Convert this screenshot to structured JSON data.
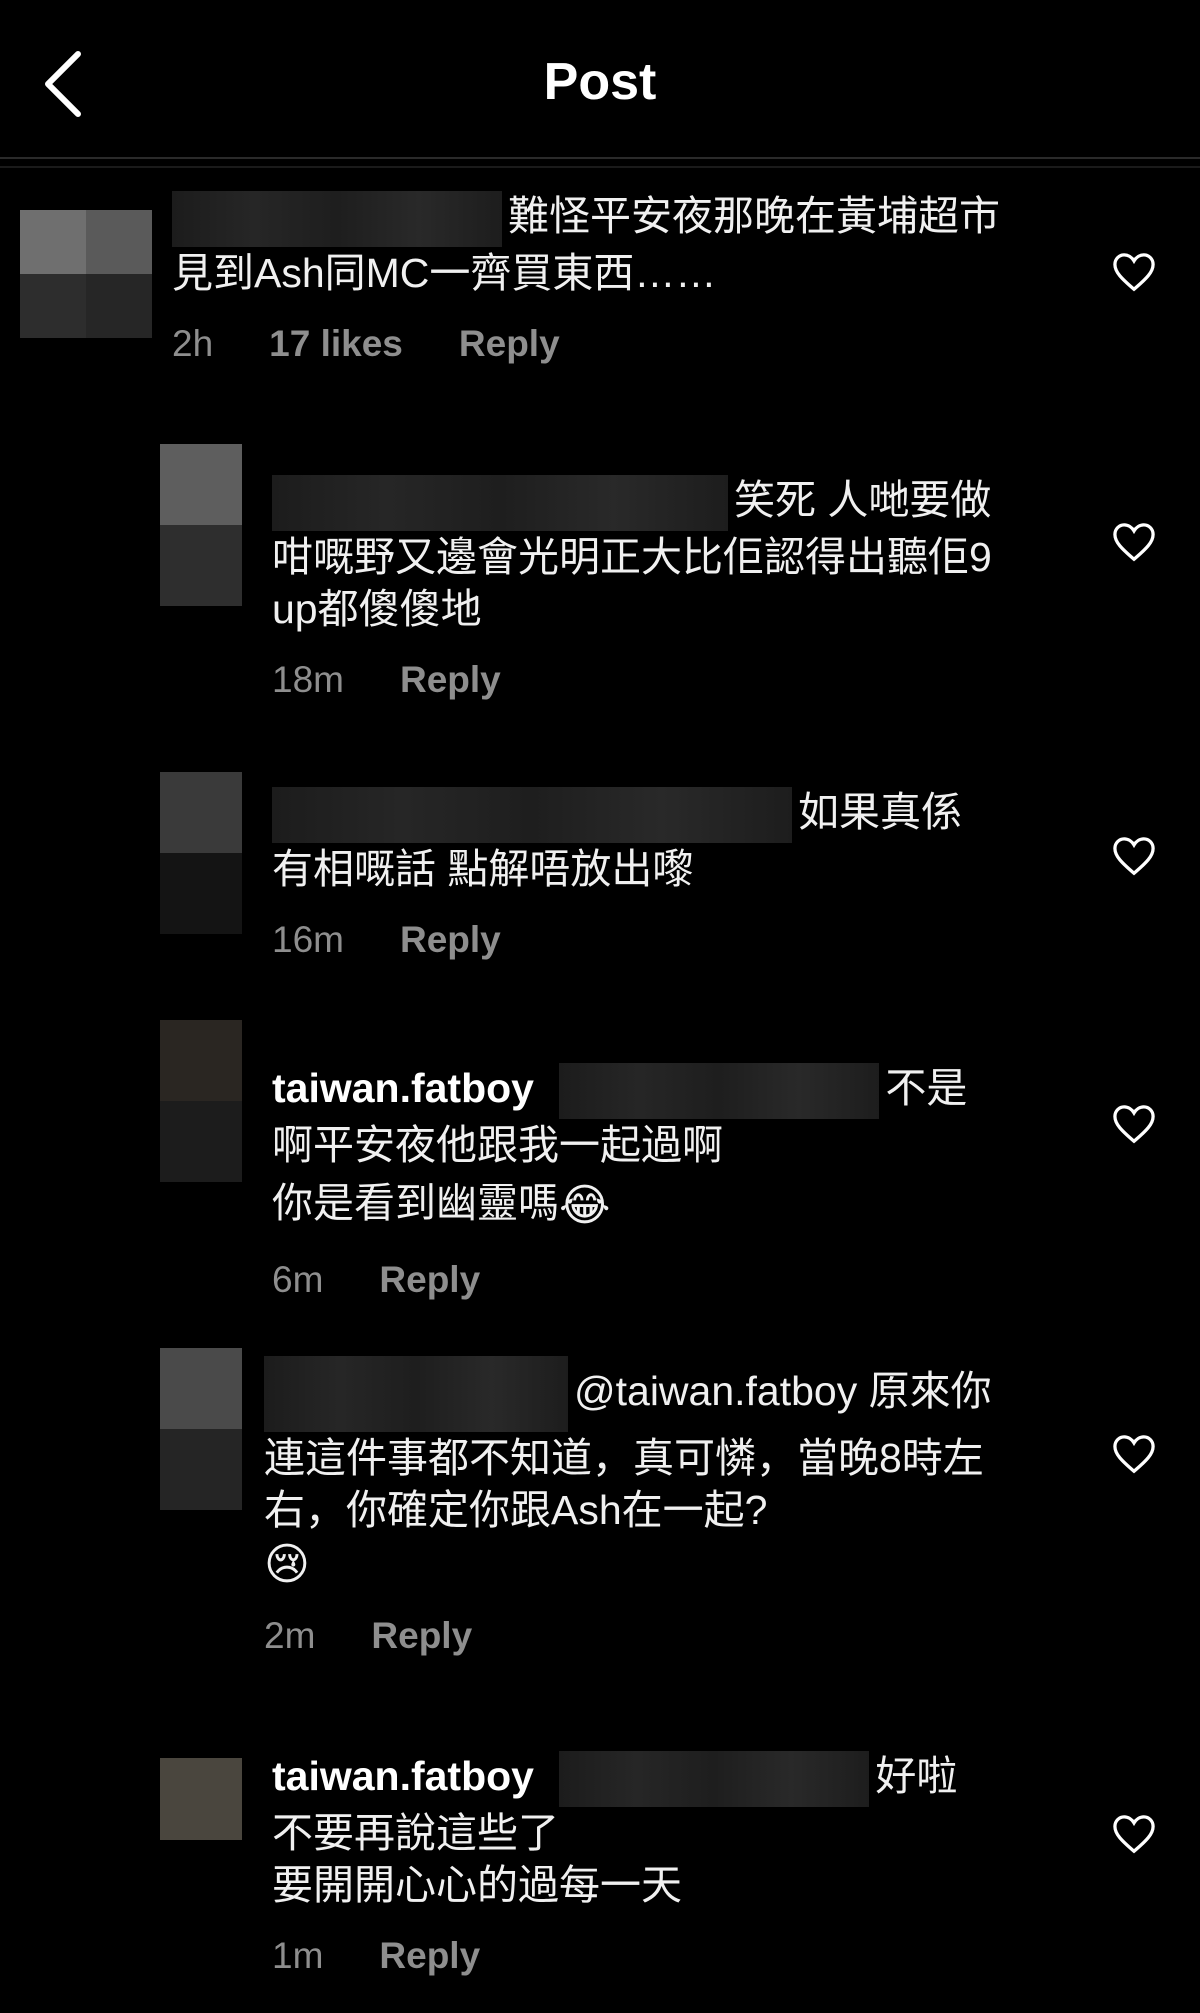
{
  "header": {
    "title": "Post",
    "back_icon": "chevron-left-icon"
  },
  "comments": [
    {
      "text": "難怪平安夜那晚在黃埔超市見到Ash同MC一齊買東西……",
      "time": "2h",
      "likes": "17 likes",
      "reply": "Reply"
    },
    {
      "text": "笑死 人哋要做咁嘅野又邊會光明正大比佢認得出聽佢9up都傻傻地",
      "time": "18m",
      "reply": "Reply"
    },
    {
      "text": "如果真係有相嘅話 點解唔放出嚟",
      "time": "16m",
      "reply": "Reply"
    },
    {
      "username": "taiwan.fatboy",
      "text_line1": "不是",
      "text_line2": "啊平安夜他跟我一起過啊",
      "text_line3": "你是看到幽靈嗎",
      "emoji": "😂",
      "time": "6m",
      "reply": "Reply"
    },
    {
      "text": "@taiwan.fatboy 原來你連這件事都不知道，真可憐，當晚8時左右，你確定你跟Ash在一起?",
      "emoji": "😢",
      "time": "2m",
      "reply": "Reply"
    },
    {
      "username": "taiwan.fatboy",
      "text_line1": "好啦",
      "text_line2": "不要再說這些了",
      "text_line3": "要開開心心的過每一天",
      "time": "1m",
      "reply": "Reply"
    }
  ],
  "colors": {
    "background": "#000000",
    "text": "#f0f0f0",
    "meta": "#8e8e8e"
  }
}
